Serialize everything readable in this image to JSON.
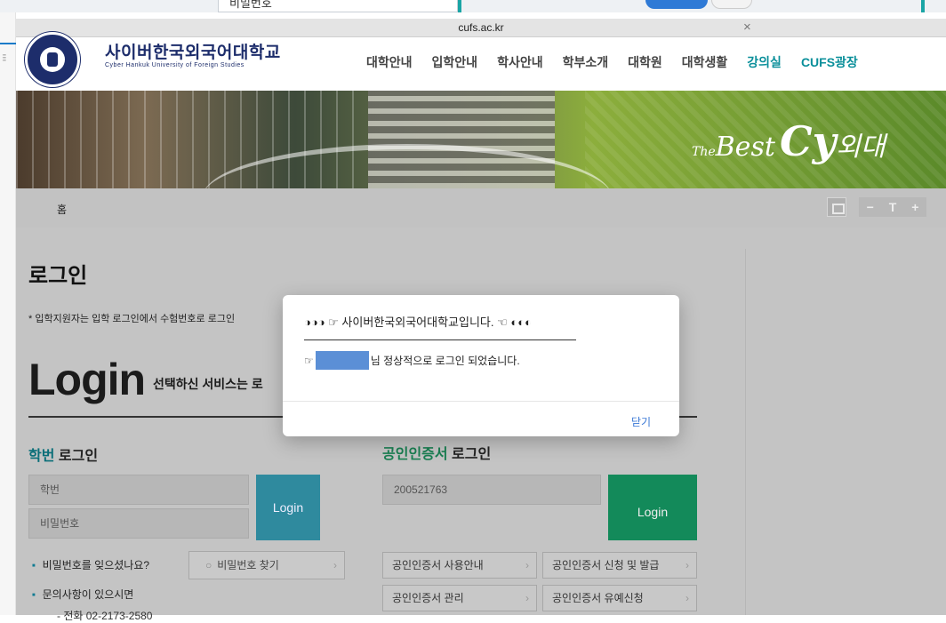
{
  "top_strip": {
    "partial_field_label": "비밀번호"
  },
  "browser": {
    "url": "cufs.ac.kr",
    "close_glyph": "×"
  },
  "header": {
    "univ_name": "사이버한국외국어대학교",
    "univ_eng": "Cyber Hankuk University of Foreign Studies",
    "nav": [
      "대학안내",
      "입학안내",
      "학사안내",
      "학부소개",
      "대학원",
      "대학생활",
      "강의실",
      "CUFS광장"
    ],
    "nav_accent": "#0a8f9a"
  },
  "banner": {
    "slogan_the": "The",
    "slogan_best": "Best",
    "slogan_cy": "Cy",
    "slogan_tail": "외대"
  },
  "breadcrumb": {
    "home": "홈"
  },
  "font_controls": {
    "minus": "−",
    "t": "T",
    "plus": "+"
  },
  "page": {
    "title": "로그인",
    "notice": "* 입학지원자는 입학 로그인에서 수험번호로 로그인",
    "login_big": "Login",
    "login_sub": "선택하신 서비스는 로"
  },
  "student_login": {
    "title_hl": "학번",
    "title_rest": " 로그인",
    "id_placeholder": "학번",
    "pw_placeholder": "비밀번호",
    "button": "Login",
    "forgot_text": "비밀번호를 잊으셨나요?",
    "find_pw_button": "비밀번호 찾기",
    "inquiry_text": "문의사항이 있으시면",
    "phone_text": "- 전화 02-2173-2580"
  },
  "cert_login": {
    "title_hl": "공인인증서",
    "title_rest": " 로그인",
    "id_value": "200521763",
    "button": "Login",
    "btn_usage": "공인인증서 사용안내",
    "btn_issue": "공인인증서 신청 및 발급",
    "btn_manage": "공인인증서 관리",
    "btn_reissue": "공인인증서 유예신청",
    "arrow": "›"
  },
  "modal": {
    "title": "◑◑◑ ☞ 사이버한국외국어대학교입니다. ☜ ◐◐◐",
    "message_prefix": "☞",
    "message_suffix": "님 정상적으로 로그인 되었습니다.",
    "close_label": "닫기"
  }
}
